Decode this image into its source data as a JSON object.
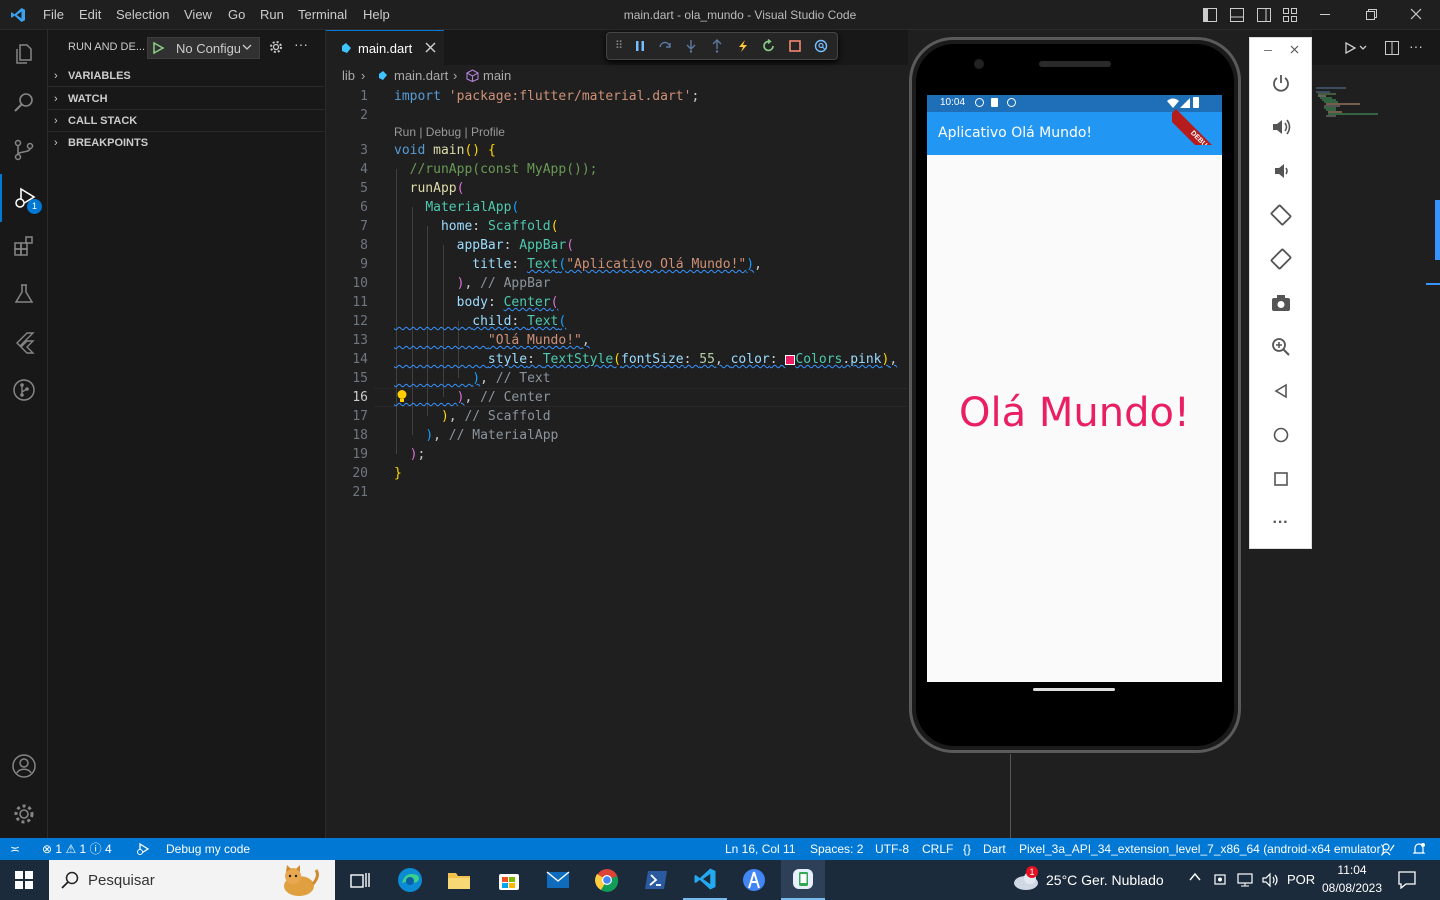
{
  "titlebar": {
    "menu": [
      "File",
      "Edit",
      "Selection",
      "View",
      "Go",
      "Run",
      "Terminal",
      "Help"
    ],
    "title": "main.dart - ola_mundo - Visual Studio Code"
  },
  "activity": {
    "debug_badge": "1"
  },
  "sidebar": {
    "title": "RUN AND DE...",
    "config": "No Configu",
    "sections": [
      "VARIABLES",
      "WATCH",
      "CALL STACK",
      "BREAKPOINTS"
    ]
  },
  "editor": {
    "tab": "main.dart",
    "breadcrumb": {
      "folder": "lib",
      "file": "main.dart",
      "symbol": "main"
    },
    "codelens": "Run | Debug | Profile",
    "line_numbers": [
      "1",
      "2",
      "3",
      "4",
      "5",
      "6",
      "7",
      "8",
      "9",
      "10",
      "11",
      "12",
      "13",
      "14",
      "15",
      "16",
      "17",
      "18",
      "19",
      "20",
      "21"
    ],
    "active_line": "16"
  },
  "emulator": {
    "time": "10:04",
    "debug_banner": "DEBUG",
    "appbar_title": "Aplicativo Olá Mundo!",
    "body_text": "Olá Mundo!",
    "pink_color": "#e91e63",
    "blue_color": "#2196f3"
  },
  "statusbar": {
    "errors": "1",
    "warnings": "1",
    "infos": "4",
    "debug_label": "Debug my code",
    "position": "Ln 16, Col 11",
    "spaces": "Spaces: 2",
    "encoding": "UTF-8",
    "eol": "CRLF",
    "language": "Dart",
    "device": "Pixel_3a_API_34_extension_level_7_x86_64 (android-x64 emulator)"
  },
  "taskbar": {
    "search_placeholder": "Pesquisar",
    "weather": "25°C  Ger. Nublado",
    "lang": "POR",
    "time": "11:04",
    "date": "08/08/2023",
    "weather_badge": "1"
  }
}
